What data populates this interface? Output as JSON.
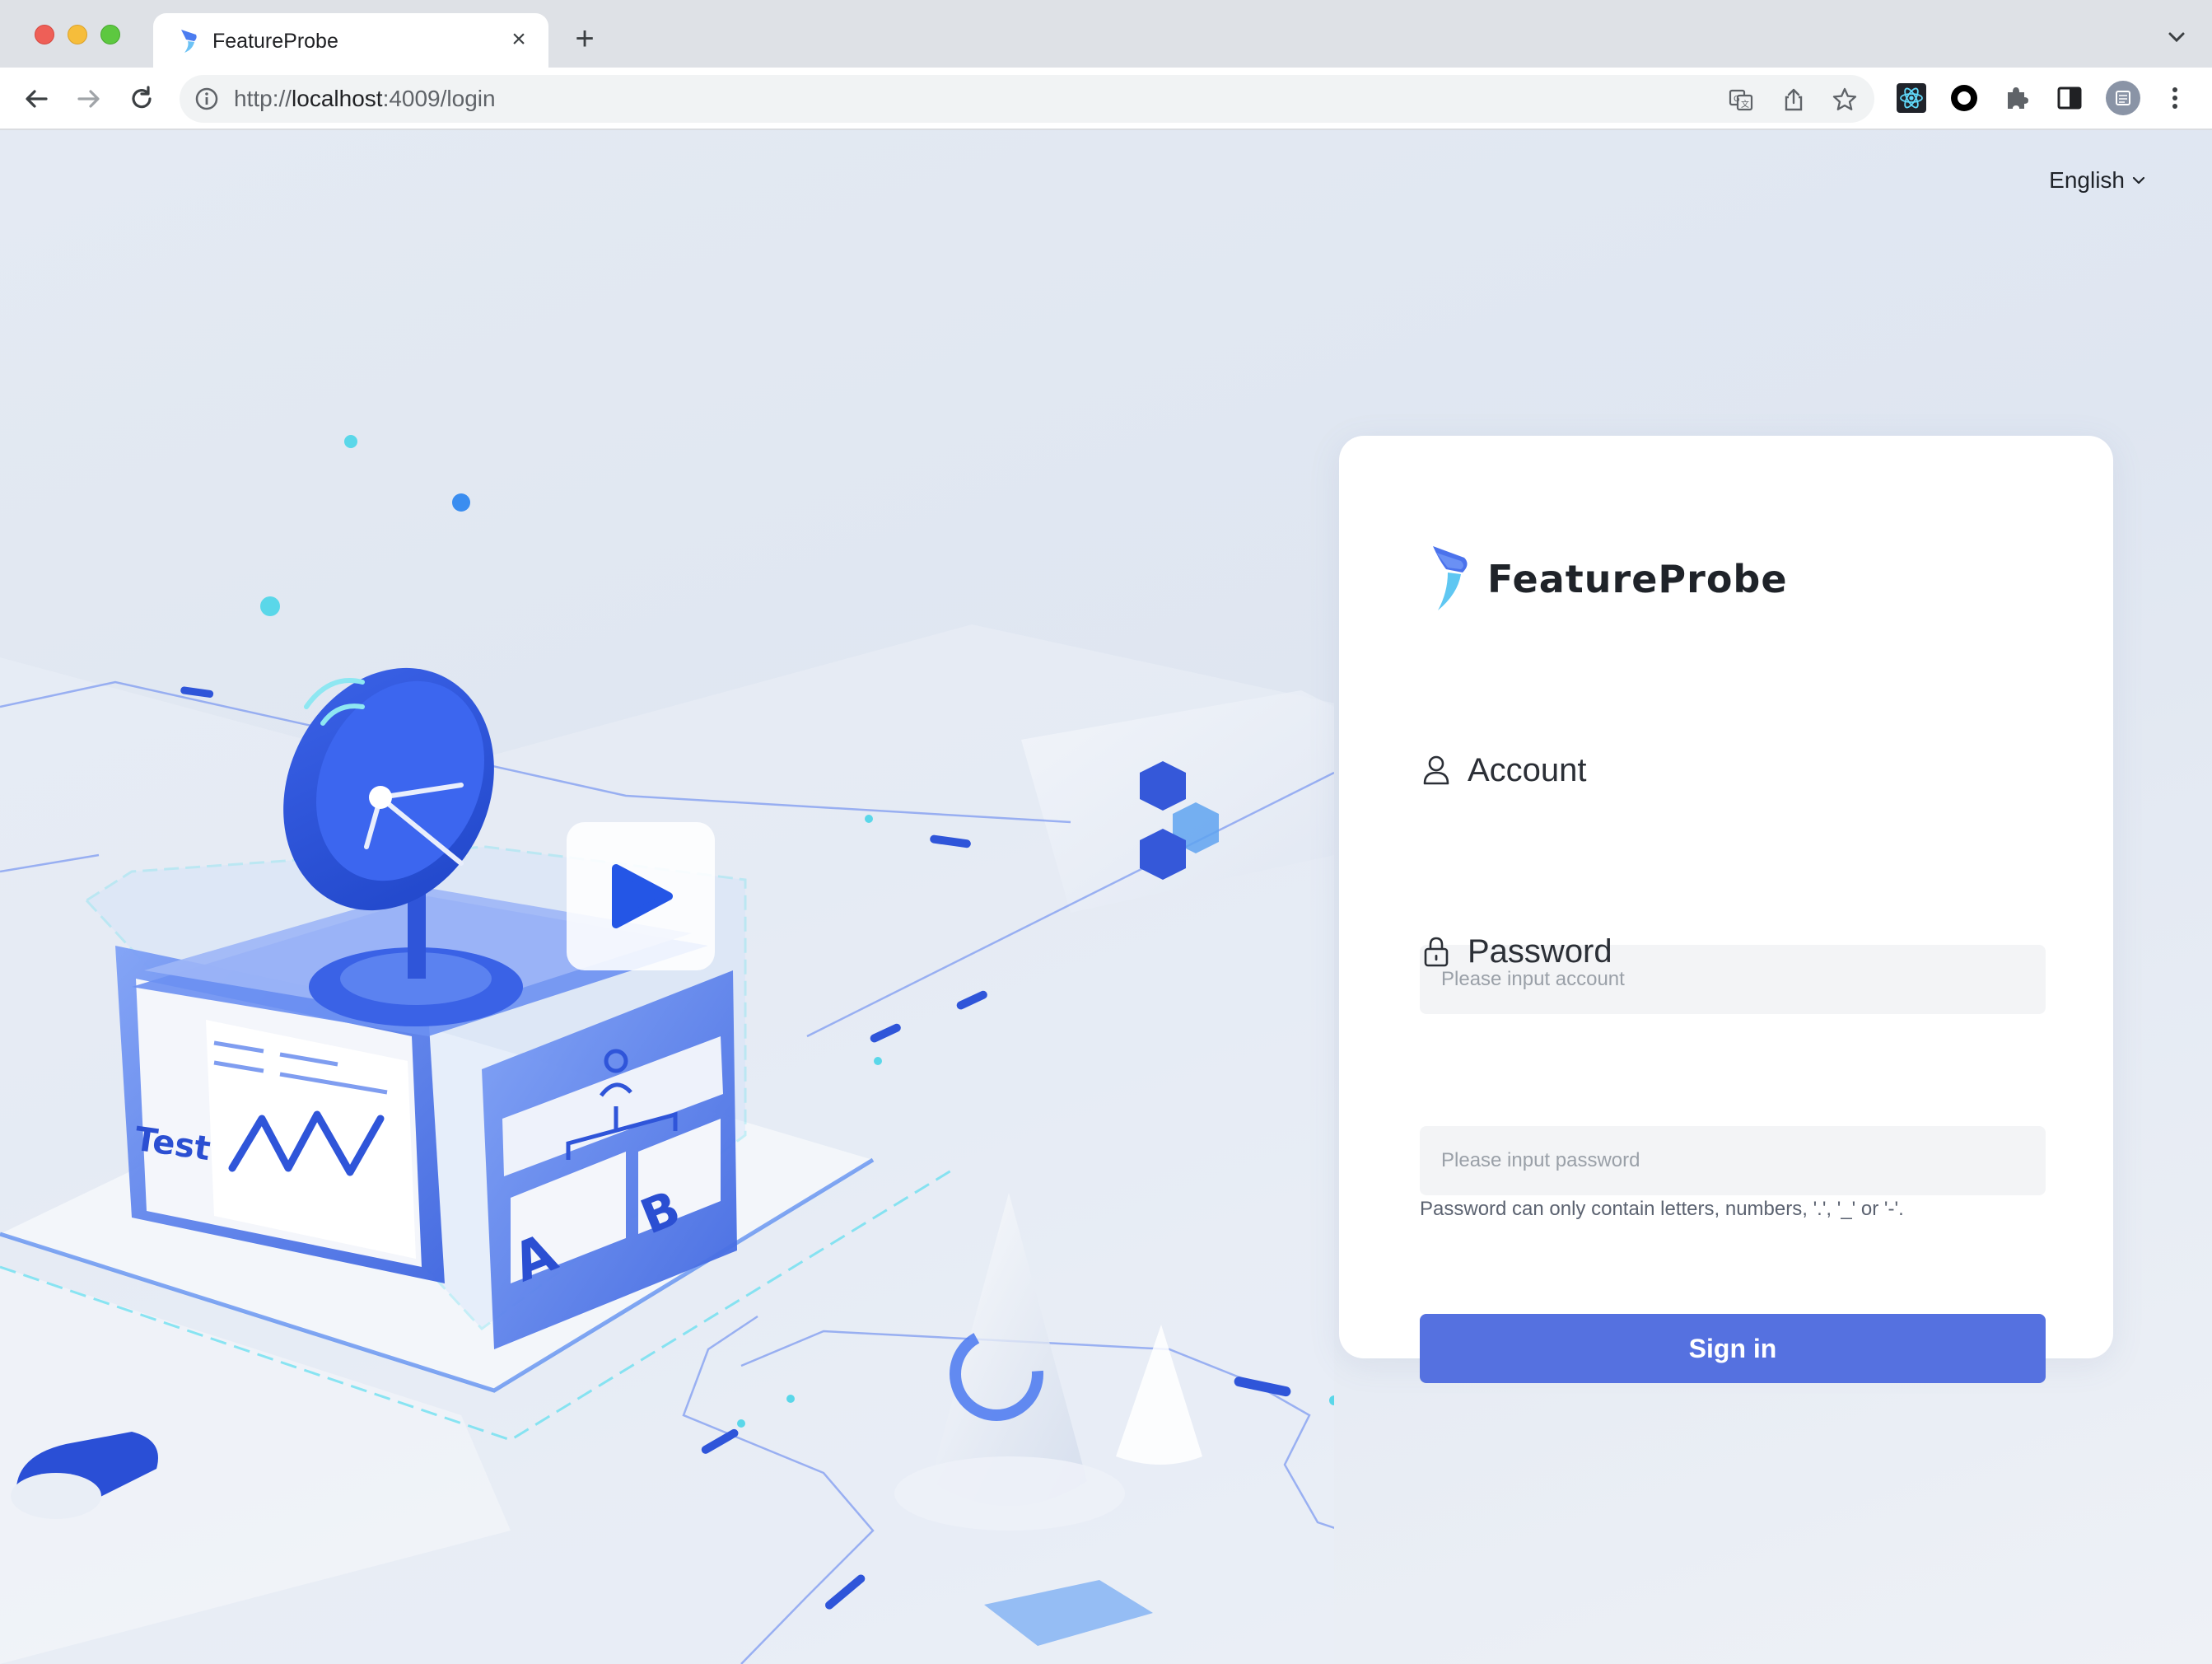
{
  "browser": {
    "tab_title": "FeatureProbe",
    "url_scheme": "http://",
    "url_host": "localhost",
    "url_rest": ":4009/login"
  },
  "page": {
    "language": "English",
    "brand": "FeatureProbe",
    "account_label": "Account",
    "account_placeholder": "Please input account",
    "password_label": "Password",
    "password_placeholder": "Please input password",
    "password_hint": "Password can only contain letters, numbers, '.', '_' or '-'.",
    "signin_label": "Sign in"
  },
  "hero": {
    "test_label": "Test",
    "group_a": "A",
    "group_b": "B"
  },
  "colors": {
    "primary": "#5571e0",
    "hero_blue": "#2f55d9",
    "card_bg": "#ffffff"
  }
}
